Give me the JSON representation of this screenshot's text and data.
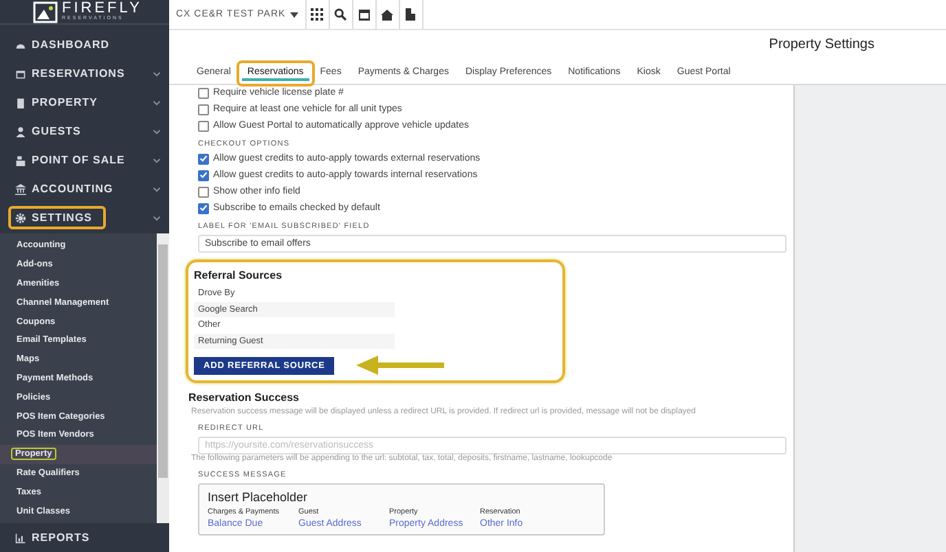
{
  "sidebar": {
    "logo": {
      "name": "FIREFLY",
      "tagline": "RESERVATIONS"
    },
    "items": [
      {
        "label": "DASHBOARD",
        "kind": "link",
        "highlighted": false
      },
      {
        "label": "RESERVATIONS",
        "kind": "group",
        "highlighted": false
      },
      {
        "label": "PROPERTY",
        "kind": "group",
        "highlighted": false
      },
      {
        "label": "GUESTS",
        "kind": "group",
        "highlighted": false
      },
      {
        "label": "POINT OF SALE",
        "kind": "group",
        "highlighted": false
      },
      {
        "label": "ACCOUNTING",
        "kind": "group",
        "highlighted": false
      },
      {
        "label": "SETTINGS",
        "kind": "group",
        "highlighted": true,
        "children": [
          {
            "label": "Accounting",
            "selected": false,
            "highlighted": false
          },
          {
            "label": "Add-ons",
            "selected": false,
            "highlighted": false
          },
          {
            "label": "Amenities",
            "selected": false,
            "highlighted": false
          },
          {
            "label": "Channel Management",
            "selected": false,
            "highlighted": false
          },
          {
            "label": "Coupons",
            "selected": false,
            "highlighted": false
          },
          {
            "label": "Email Templates",
            "selected": false,
            "highlighted": false
          },
          {
            "label": "Maps",
            "selected": false,
            "highlighted": false
          },
          {
            "label": "Payment Methods",
            "selected": false,
            "highlighted": false
          },
          {
            "label": "Policies",
            "selected": false,
            "highlighted": false
          },
          {
            "label": "POS Item Categories",
            "selected": false,
            "highlighted": false
          },
          {
            "label": "POS Item Vendors",
            "selected": false,
            "highlighted": false
          },
          {
            "label": "Property",
            "selected": true,
            "highlighted": true
          },
          {
            "label": "Rate Qualifiers",
            "selected": false,
            "highlighted": false
          },
          {
            "label": "Taxes",
            "selected": false,
            "highlighted": false
          },
          {
            "label": "Unit Classes",
            "selected": false,
            "highlighted": false
          }
        ]
      },
      {
        "label": "REPORTS",
        "kind": "link",
        "highlighted": false
      }
    ]
  },
  "topbar": {
    "park_selector": "CX CE&R TEST PARK"
  },
  "page_title": "Property Settings",
  "tabs": [
    {
      "label": "General",
      "selected": false,
      "highlighted": false
    },
    {
      "label": "Reservations",
      "selected": true,
      "highlighted": true
    },
    {
      "label": "Fees",
      "selected": false,
      "highlighted": false
    },
    {
      "label": "Payments & Charges",
      "selected": false,
      "highlighted": false
    },
    {
      "label": "Display Preferences",
      "selected": false,
      "highlighted": false
    },
    {
      "label": "Notifications",
      "selected": false,
      "highlighted": false
    },
    {
      "label": "Kiosk",
      "selected": false,
      "highlighted": false
    },
    {
      "label": "Guest Portal",
      "selected": false,
      "highlighted": false
    }
  ],
  "vehicle_options": [
    {
      "label": "Require vehicle license plate #",
      "checked": false
    },
    {
      "label": "Require at least one vehicle for all unit types",
      "checked": false
    },
    {
      "label": "Allow Guest Portal to automatically approve vehicle updates",
      "checked": false
    }
  ],
  "checkout_options": {
    "heading": "CHECKOUT OPTIONS",
    "options": [
      {
        "label": "Allow guest credits to auto-apply towards external reservations",
        "checked": true
      },
      {
        "label": "Allow guest credits to auto-apply towards internal reservations",
        "checked": true
      },
      {
        "label": "Show other info field",
        "checked": false
      },
      {
        "label": "Subscribe to emails checked by default",
        "checked": true
      }
    ]
  },
  "email_subscribed_field": {
    "label": "LABEL FOR 'EMAIL SUBSCRIBED' FIELD",
    "value": "Subscribe to email offers"
  },
  "referral_sources": {
    "title": "Referral Sources",
    "highlighted": true,
    "pointer_arrow": true,
    "items": [
      "Drove By",
      "Google Search",
      "Other",
      "Returning Guest"
    ],
    "button": "ADD REFERRAL SOURCE"
  },
  "reservation_success": {
    "title": "Reservation Success",
    "description": "Reservation success message will be displayed unless a redirect URL is provided. If redirect url is provided, message will not be displayed",
    "redirect_label": "REDIRECT URL",
    "redirect_placeholder": "https://yoursite.com/reservationsuccess",
    "redirect_help": "The following parameters will be appending to the url: subtotal, tax, total, deposits, firstname, lastname, lookupcode",
    "message_label": "SUCCESS MESSAGE",
    "placeholder_panel": {
      "title": "Insert Placeholder",
      "columns": [
        {
          "heading": "Charges & Payments",
          "links": [
            "Balance Due"
          ]
        },
        {
          "heading": "Guest",
          "links": [
            "Guest Address"
          ]
        },
        {
          "heading": "Property",
          "links": [
            "Property Address"
          ]
        },
        {
          "heading": "Reservation",
          "links": [
            "Other Info"
          ]
        }
      ]
    }
  }
}
